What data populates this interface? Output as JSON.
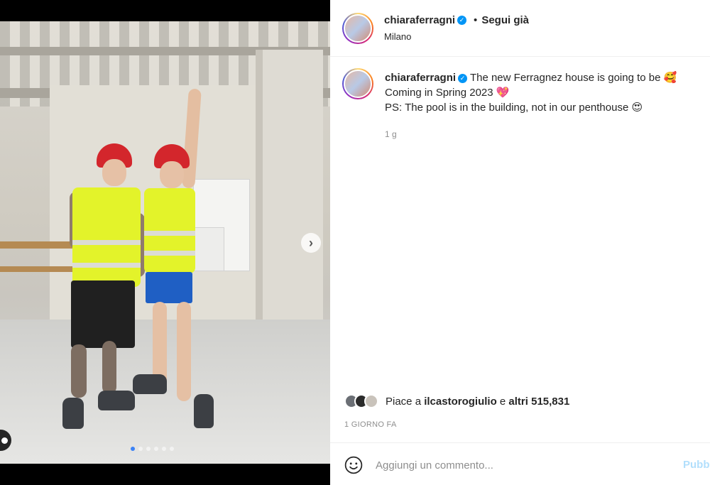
{
  "post": {
    "username": "chiaraferragni",
    "verified_mark": "✓",
    "separator": "•",
    "follow_status": "Segui già",
    "location": "Milano"
  },
  "caption": {
    "username": "chiaraferragni",
    "line1": "The new Ferragnez house is going to be",
    "line1_emoji": "🥰",
    "line2": "Coming in Spring 2023",
    "line2_emoji": "💖",
    "line3": "PS: The pool is in the building, not in our penthouse",
    "line3_emoji": "😍",
    "time_ago": "1 g"
  },
  "likes": {
    "prefix": "Piace a",
    "liker": "ilcastorogiulio",
    "connector": "e",
    "others": "altri 515,831"
  },
  "date_label": "1 GIORNO FA",
  "comment": {
    "placeholder": "Aggiungi un commento...",
    "publish_label": "Pubb"
  },
  "carousel": {
    "slide_count": 6,
    "active_index": 0,
    "next_icon": "chevron-right-icon"
  },
  "colors": {
    "verified_blue": "#0095f6",
    "publish_disabled": "#b2dffc",
    "carousel_dot_active": "#3b82f6",
    "secondary_text": "#8e8e8e"
  }
}
